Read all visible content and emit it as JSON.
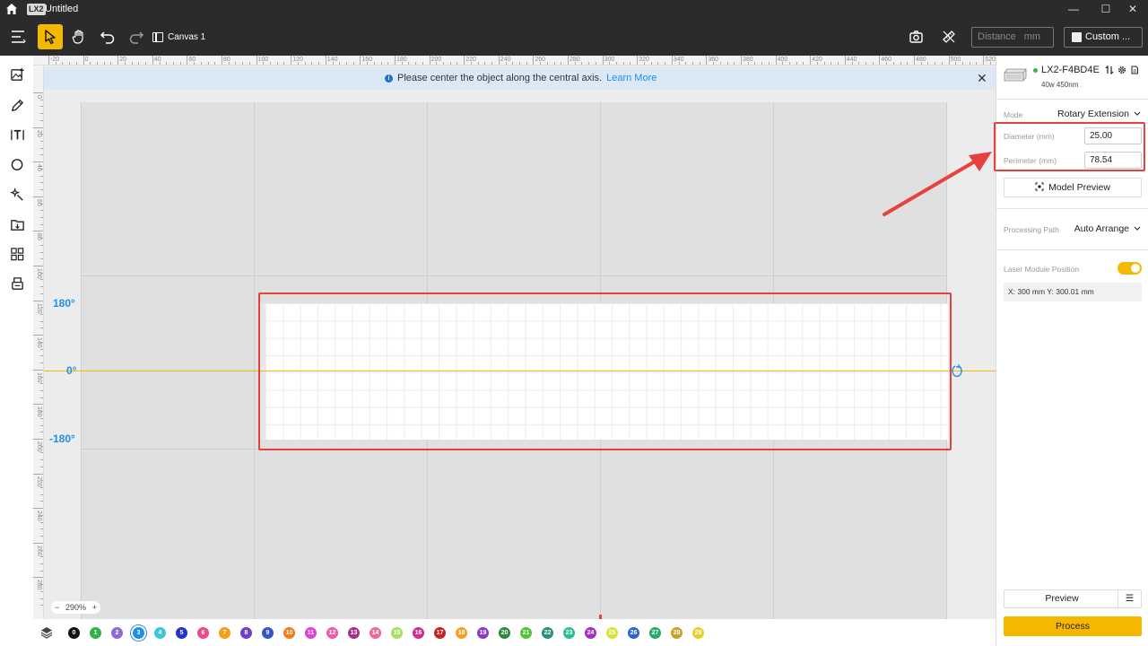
{
  "window": {
    "logo": "LX2",
    "title": "Untitled",
    "controls": [
      "—",
      "☐",
      "✕"
    ]
  },
  "toolbar": {
    "canvas_tab": "Canvas 1",
    "distance_placeholder": "Distance",
    "distance_unit": "mm",
    "custom_label": "Custom ..."
  },
  "banner": {
    "message": "Please center the object along the central axis.",
    "link": "Learn More",
    "close": "✕"
  },
  "ruler_top": [
    "-20",
    "0",
    "20",
    "40",
    "60",
    "80",
    "100",
    "120",
    "140",
    "160",
    "180",
    "200",
    "220",
    "240",
    "260",
    "280",
    "300",
    "320",
    "340",
    "360",
    "380",
    "400",
    "420",
    "440",
    "460",
    "480",
    "500",
    "520"
  ],
  "ruler_left": [
    "0",
    "20",
    "40",
    "60",
    "80",
    "100",
    "120",
    "140",
    "160",
    "180",
    "200",
    "220",
    "240",
    "260",
    "280"
  ],
  "canvas": {
    "deg_top": "180°",
    "deg_mid": "0°",
    "deg_bottom": "-180°"
  },
  "zoom": {
    "minus": "−",
    "level": "290%",
    "plus": "+"
  },
  "palette": [
    "0",
    "1",
    "2",
    "3",
    "4",
    "5",
    "6",
    "7",
    "8",
    "9",
    "10",
    "11",
    "12",
    "13",
    "14",
    "15",
    "16",
    "17",
    "18",
    "19",
    "20",
    "21",
    "22",
    "23",
    "24",
    "25",
    "26",
    "27",
    "28",
    "29"
  ],
  "palette_colors": [
    "#111111",
    "#2fb34a",
    "#8c6bd6",
    "#1d8fe6",
    "#3cc7d8",
    "#2533c9",
    "#e94a8a",
    "#f29d1b",
    "#6f3fc4",
    "#3355cc",
    "#f07d1a",
    "#e23fd6",
    "#ee5aa6",
    "#a43488",
    "#ea6a9a",
    "#a6e060",
    "#c93090",
    "#c72323",
    "#f2a324",
    "#8a3cc9",
    "#2a8a3a",
    "#55c23a",
    "#2d8f7a",
    "#2ebf8f",
    "#a32fc4",
    "#d8e23a",
    "#2f65c9",
    "#2ca86a",
    "#c9a02a",
    "#e8d02a"
  ],
  "palette_selected": "3",
  "device": {
    "name": "LX2-F4BD4E",
    "spec": "40w 450nm"
  },
  "panel": {
    "mode_label": "Mode",
    "mode_value": "Rotary Extension",
    "diameter_label": "Diameter  (mm)",
    "diameter_value": "25.00",
    "perimeter_label": "Perimeter  (mm)",
    "perimeter_value": "78.54",
    "model_preview": "Model Preview",
    "path_label": "Processing Path",
    "path_value": "Auto Arrange",
    "laser_label": "Laser Module Position",
    "laser_enabled": true,
    "coords": "X: 300 mm   Y: 300.01 mm",
    "preview": "Preview",
    "menu": "☰",
    "process": "Process"
  },
  "colors": {
    "accent": "#f5b800",
    "highlight": "#e8403e",
    "link": "#1d8fe6"
  }
}
